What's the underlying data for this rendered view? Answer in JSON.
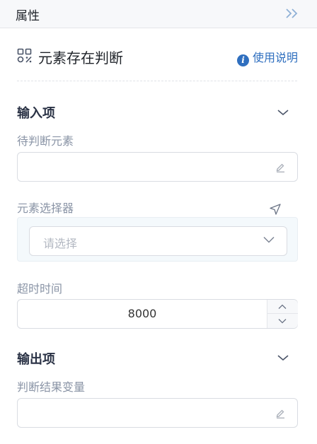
{
  "header": {
    "title": "属性",
    "collapse_icon": "double-chevron-right-icon"
  },
  "component": {
    "icon": "element-grid-icon",
    "title": "元素存在判断"
  },
  "help": {
    "icon": "info-icon",
    "glyph": "i",
    "label": "使用说明"
  },
  "input_section": {
    "title": "输入项",
    "fields": {
      "element_to_check": {
        "label": "待判断元素",
        "value": "",
        "icon": "edit-icon"
      },
      "element_selector": {
        "label": "元素选择器",
        "placeholder": "请选择",
        "pick_icon": "pick-pointer-icon"
      },
      "timeout": {
        "label": "超时时间",
        "value": "8000"
      }
    }
  },
  "output_section": {
    "title": "输出项",
    "fields": {
      "result_variable": {
        "label": "判断结果变量",
        "value": "",
        "icon": "edit-icon"
      }
    }
  },
  "colors": {
    "accent": "#2f6fbf",
    "label": "#8a94a6",
    "border": "#d9dce2",
    "selector_bg": "#f4f9fc"
  }
}
